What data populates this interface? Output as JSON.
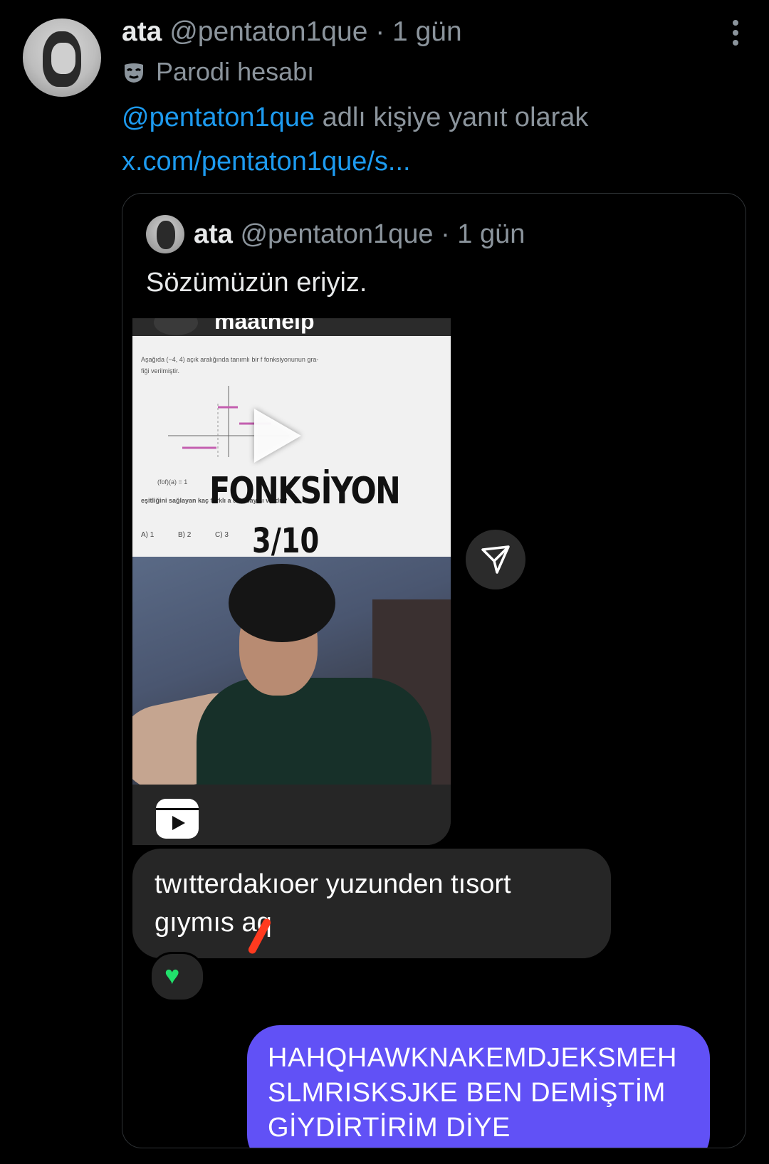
{
  "tweet": {
    "author_name": "ata",
    "author_handle": "@pentaton1que",
    "time": "· 1 gün",
    "label_icon": "mask-icon",
    "label": "Parodi hesabı",
    "reply_to_handle": "@pentaton1que",
    "reply_to_suffix": " adlı kişiye yanıt olarak",
    "link_text": "x.com/pentaton1que/s..."
  },
  "quote": {
    "author_name": "ata",
    "author_handle": "@pentaton1que",
    "time": "· 1 gün",
    "text": "Sözümüzün eriyiz."
  },
  "dm": {
    "account": "maathelp",
    "overlay_title": "FONKSİYON",
    "overlay_score": "3/10",
    "incoming_line1": "twıtterdakıoer yuzunden tısort",
    "incoming_line2": "gıymıs aq",
    "reaction": "♥",
    "outgoing_line1": "HAHQHAWKNAKEMDJEKSMEH",
    "outgoing_line2": "SLMRISKSJKE BEN DEMİŞTİM",
    "outgoing_line3": "GİYDİRTİRİM DİYE"
  },
  "colors": {
    "link": "#1d9bf0",
    "muted": "#8b949c",
    "outgoing_bubble": "#6151f6",
    "incoming_bubble": "#262626",
    "reaction_heart": "#21e06b"
  }
}
